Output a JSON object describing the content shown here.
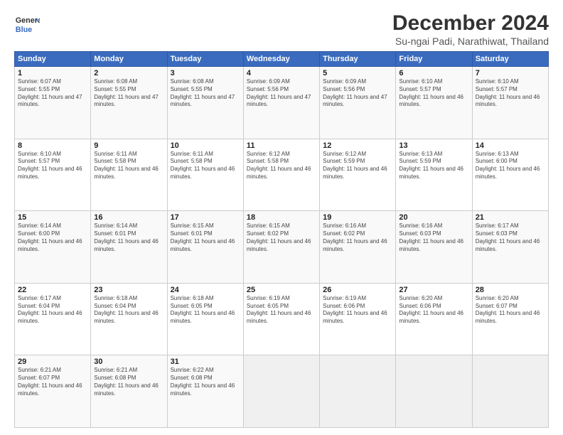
{
  "header": {
    "logo_line1": "General",
    "logo_line2": "Blue",
    "title": "December 2024",
    "subtitle": "Su-ngai Padi, Narathiwat, Thailand"
  },
  "weekdays": [
    "Sunday",
    "Monday",
    "Tuesday",
    "Wednesday",
    "Thursday",
    "Friday",
    "Saturday"
  ],
  "weeks": [
    [
      {
        "day": "1",
        "sunrise": "6:07 AM",
        "sunset": "5:55 PM",
        "daylight": "11 hours and 47 minutes."
      },
      {
        "day": "2",
        "sunrise": "6:08 AM",
        "sunset": "5:55 PM",
        "daylight": "11 hours and 47 minutes."
      },
      {
        "day": "3",
        "sunrise": "6:08 AM",
        "sunset": "5:55 PM",
        "daylight": "11 hours and 47 minutes."
      },
      {
        "day": "4",
        "sunrise": "6:09 AM",
        "sunset": "5:56 PM",
        "daylight": "11 hours and 47 minutes."
      },
      {
        "day": "5",
        "sunrise": "6:09 AM",
        "sunset": "5:56 PM",
        "daylight": "11 hours and 47 minutes."
      },
      {
        "day": "6",
        "sunrise": "6:10 AM",
        "sunset": "5:57 PM",
        "daylight": "11 hours and 46 minutes."
      },
      {
        "day": "7",
        "sunrise": "6:10 AM",
        "sunset": "5:57 PM",
        "daylight": "11 hours and 46 minutes."
      }
    ],
    [
      {
        "day": "8",
        "sunrise": "6:10 AM",
        "sunset": "5:57 PM",
        "daylight": "11 hours and 46 minutes."
      },
      {
        "day": "9",
        "sunrise": "6:11 AM",
        "sunset": "5:58 PM",
        "daylight": "11 hours and 46 minutes."
      },
      {
        "day": "10",
        "sunrise": "6:11 AM",
        "sunset": "5:58 PM",
        "daylight": "11 hours and 46 minutes."
      },
      {
        "day": "11",
        "sunrise": "6:12 AM",
        "sunset": "5:58 PM",
        "daylight": "11 hours and 46 minutes."
      },
      {
        "day": "12",
        "sunrise": "6:12 AM",
        "sunset": "5:59 PM",
        "daylight": "11 hours and 46 minutes."
      },
      {
        "day": "13",
        "sunrise": "6:13 AM",
        "sunset": "5:59 PM",
        "daylight": "11 hours and 46 minutes."
      },
      {
        "day": "14",
        "sunrise": "6:13 AM",
        "sunset": "6:00 PM",
        "daylight": "11 hours and 46 minutes."
      }
    ],
    [
      {
        "day": "15",
        "sunrise": "6:14 AM",
        "sunset": "6:00 PM",
        "daylight": "11 hours and 46 minutes."
      },
      {
        "day": "16",
        "sunrise": "6:14 AM",
        "sunset": "6:01 PM",
        "daylight": "11 hours and 46 minutes."
      },
      {
        "day": "17",
        "sunrise": "6:15 AM",
        "sunset": "6:01 PM",
        "daylight": "11 hours and 46 minutes."
      },
      {
        "day": "18",
        "sunrise": "6:15 AM",
        "sunset": "6:02 PM",
        "daylight": "11 hours and 46 minutes."
      },
      {
        "day": "19",
        "sunrise": "6:16 AM",
        "sunset": "6:02 PM",
        "daylight": "11 hours and 46 minutes."
      },
      {
        "day": "20",
        "sunrise": "6:16 AM",
        "sunset": "6:03 PM",
        "daylight": "11 hours and 46 minutes."
      },
      {
        "day": "21",
        "sunrise": "6:17 AM",
        "sunset": "6:03 PM",
        "daylight": "11 hours and 46 minutes."
      }
    ],
    [
      {
        "day": "22",
        "sunrise": "6:17 AM",
        "sunset": "6:04 PM",
        "daylight": "11 hours and 46 minutes."
      },
      {
        "day": "23",
        "sunrise": "6:18 AM",
        "sunset": "6:04 PM",
        "daylight": "11 hours and 46 minutes."
      },
      {
        "day": "24",
        "sunrise": "6:18 AM",
        "sunset": "6:05 PM",
        "daylight": "11 hours and 46 minutes."
      },
      {
        "day": "25",
        "sunrise": "6:19 AM",
        "sunset": "6:05 PM",
        "daylight": "11 hours and 46 minutes."
      },
      {
        "day": "26",
        "sunrise": "6:19 AM",
        "sunset": "6:06 PM",
        "daylight": "11 hours and 46 minutes."
      },
      {
        "day": "27",
        "sunrise": "6:20 AM",
        "sunset": "6:06 PM",
        "daylight": "11 hours and 46 minutes."
      },
      {
        "day": "28",
        "sunrise": "6:20 AM",
        "sunset": "6:07 PM",
        "daylight": "11 hours and 46 minutes."
      }
    ],
    [
      {
        "day": "29",
        "sunrise": "6:21 AM",
        "sunset": "6:07 PM",
        "daylight": "11 hours and 46 minutes."
      },
      {
        "day": "30",
        "sunrise": "6:21 AM",
        "sunset": "6:08 PM",
        "daylight": "11 hours and 46 minutes."
      },
      {
        "day": "31",
        "sunrise": "6:22 AM",
        "sunset": "6:08 PM",
        "daylight": "11 hours and 46 minutes."
      },
      null,
      null,
      null,
      null
    ]
  ],
  "labels": {
    "sunrise": "Sunrise:",
    "sunset": "Sunset:",
    "daylight": "Daylight:"
  }
}
